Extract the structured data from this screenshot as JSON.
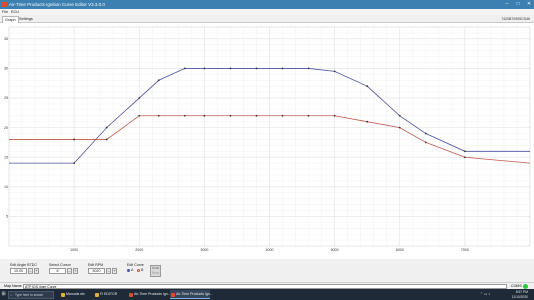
{
  "window": {
    "title": "Air-Time Products Ignition Curve Editor V3.3.0.0",
    "controls": [
      "–",
      "□",
      "✕"
    ]
  },
  "menu": {
    "items": [
      "File",
      "ECU"
    ]
  },
  "tabs": [
    {
      "label": "Graph"
    },
    {
      "label": "Settings"
    }
  ],
  "serial": "7420B70905CD46",
  "colors": {
    "blue_curve": "#4a4f9e",
    "red_curve": "#c0574a",
    "grid": "#e2e2e2",
    "connected": "#2bc93a",
    "titlebar": "#3c7fb1"
  },
  "chart_data": {
    "type": "line",
    "x_ticks": [
      "1000",
      "2000",
      "3000",
      "4000",
      "5000",
      "6000",
      "7000"
    ],
    "y_ticks": [
      "5",
      "10",
      "15",
      "20",
      "25",
      "30",
      "35"
    ],
    "xlim": [
      0,
      8000
    ],
    "ylim": [
      0,
      37
    ],
    "grid": true,
    "series": [
      {
        "color": "#4a4f9e",
        "x": [
          0,
          1000,
          1500,
          2000,
          2300,
          2700,
          3000,
          3400,
          3800,
          4200,
          4600,
          5000,
          5500,
          6000,
          6400,
          7000,
          8000
        ],
        "y": [
          14,
          14,
          20,
          25,
          28,
          30,
          30,
          30,
          30,
          30,
          30,
          29.5,
          27,
          22,
          19,
          16,
          16
        ]
      },
      {
        "color": "#c0574a",
        "x": [
          0,
          1000,
          1500,
          2000,
          2300,
          2700,
          3000,
          3400,
          3800,
          4200,
          4600,
          5000,
          5500,
          6000,
          6400,
          7000,
          8000
        ],
        "y": [
          18,
          18,
          18,
          22,
          22,
          22,
          22,
          22,
          22,
          22,
          22,
          22,
          21,
          20,
          17.5,
          15,
          14
        ]
      }
    ]
  },
  "controls": {
    "edit_angle_label": "Edit Angle BTDC",
    "edit_angle_value": "10.00",
    "select_cursor_label": "Select Cursor",
    "select_cursor_value": "8",
    "edit_rpm_label": "Edit RPM",
    "edit_rpm_value": "5020",
    "edit_curve_label": "Edit Curve",
    "curve_a": "A",
    "curve_b": "B",
    "undo_label": "Undo",
    "undo_sub": "Redo",
    "minus": "–",
    "plus": "+"
  },
  "status": {
    "map_name_label": "Map Name",
    "map_name_value": "ATP IDS 4mm Curve",
    "conn_label": "COMS"
  },
  "taskbar": {
    "search_placeholder": "Type here to search",
    "apps": [
      {
        "label": "Manuals etc",
        "color": "#e2b23a"
      },
      {
        "label": "FI EDITOR",
        "color": "#e2b23a"
      },
      {
        "label": "Air-Time Products Ign...",
        "color": "#e04a2a"
      },
      {
        "label": "Air-Time Products Ign...",
        "color": "#e04a2a"
      }
    ],
    "time": "8:57 PM",
    "date": "11/10/2020"
  }
}
